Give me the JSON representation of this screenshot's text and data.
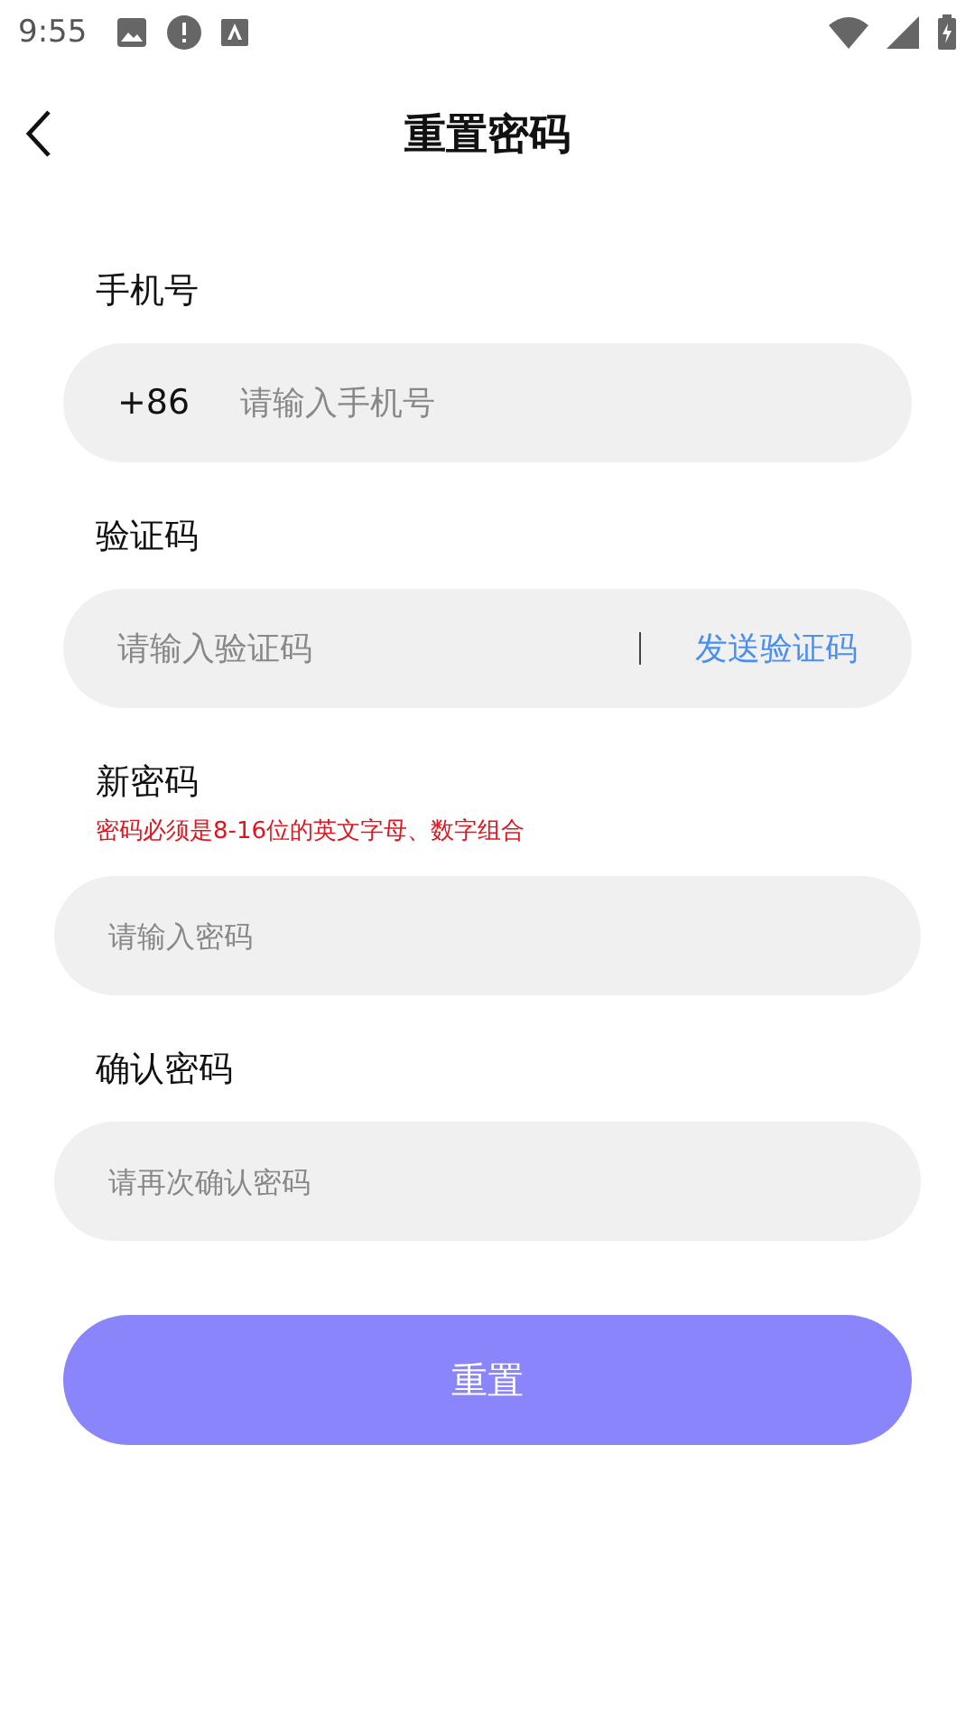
{
  "status_bar": {
    "time": "9:55"
  },
  "header": {
    "title": "重置密码"
  },
  "fields": [
    {
      "kind": "phone",
      "label": "手机号",
      "prefix": "+86",
      "placeholder": "请输入手机号"
    },
    {
      "kind": "code",
      "label": "验证码",
      "placeholder": "请输入验证码",
      "action": "发送验证码"
    },
    {
      "kind": "password",
      "label": "新密码",
      "hint": "密码必须是8-16位的英文字母、数字组合",
      "placeholder": "请输入密码"
    },
    {
      "kind": "password",
      "label": "确认密码",
      "placeholder": "请再次确认密码"
    }
  ],
  "submit_button": "重置"
}
